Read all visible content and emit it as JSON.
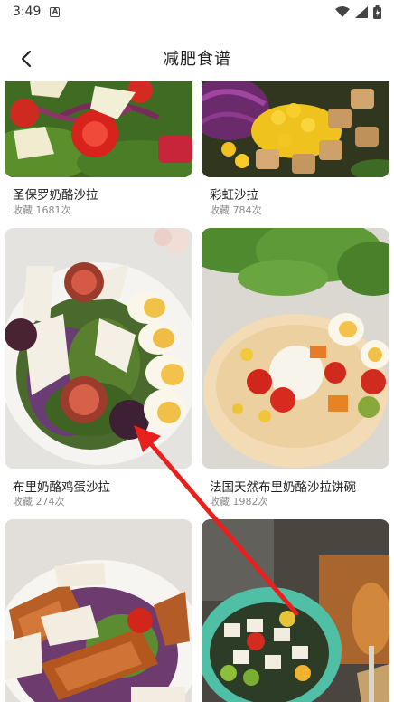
{
  "status_bar": {
    "time": "3:49",
    "notification_icon": "a-box-icon",
    "icons": [
      "wifi-icon",
      "signal-icon",
      "battery-icon"
    ]
  },
  "header": {
    "title": "减肥食谱",
    "back_icon": "chevron-left-icon"
  },
  "recipes": [
    {
      "name": "圣保罗奶酪沙拉",
      "favorites": "收藏 1681次"
    },
    {
      "name": "彩虹沙拉",
      "favorites": "收藏 784次"
    },
    {
      "name": "布里奶酪鸡蛋沙拉",
      "favorites": "收藏 274次"
    },
    {
      "name": "法国天然布里奶酪沙拉饼碗",
      "favorites": "收藏 1982次"
    },
    {
      "name": "",
      "favorites": ""
    },
    {
      "name": "",
      "favorites": ""
    }
  ],
  "colors": {
    "accent_arrow": "#e8201e",
    "title_text": "#222222",
    "meta_text": "#8a8a8a"
  }
}
